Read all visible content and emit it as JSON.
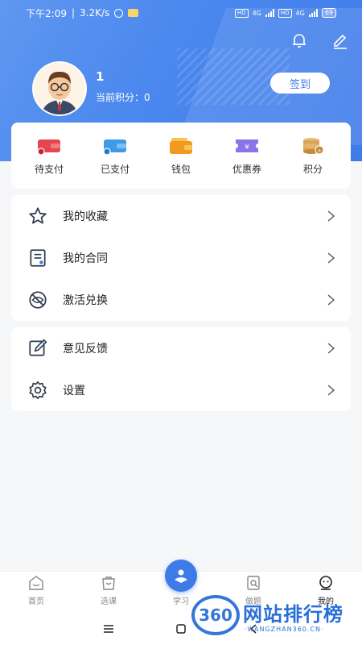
{
  "status_bar": {
    "time": "下午2:09",
    "speed": "3.2K/s",
    "network_1": "4G",
    "network_2": "4G",
    "hd": "HD",
    "battery": "69"
  },
  "header": {
    "user_name": "1",
    "points_text": "当前积分：0",
    "checkin_label": "签到",
    "colors": {
      "primary": "#3f7be8",
      "gradient_start": "#5f97f0"
    }
  },
  "quick_actions": [
    {
      "label": "待支付",
      "icon": "wallet-pending-icon",
      "color": "#e6464f"
    },
    {
      "label": "已支付",
      "icon": "wallet-paid-icon",
      "color": "#3f9be8"
    },
    {
      "label": "钱包",
      "icon": "wallet-icon",
      "color": "#f29a1f"
    },
    {
      "label": "优惠券",
      "icon": "coupon-icon",
      "color": "#8a74e8"
    },
    {
      "label": "积分",
      "icon": "coins-icon",
      "color": "#d9a55a"
    }
  ],
  "menu_group_1": [
    {
      "label": "我的收藏",
      "icon": "star-icon"
    },
    {
      "label": "我的合同",
      "icon": "contract-icon"
    },
    {
      "label": "激活兑换",
      "icon": "activate-icon"
    }
  ],
  "menu_group_2": [
    {
      "label": "意见反馈",
      "icon": "feedback-icon"
    },
    {
      "label": "设置",
      "icon": "gear-icon"
    }
  ],
  "bottom_nav": [
    {
      "label": "首页",
      "icon": "home-icon",
      "active": false
    },
    {
      "label": "选课",
      "icon": "course-select-icon",
      "active": false
    },
    {
      "label": "学习",
      "icon": "study-icon",
      "active": false
    },
    {
      "label": "做题",
      "icon": "exercise-icon",
      "active": false
    },
    {
      "label": "我的",
      "icon": "profile-icon",
      "active": true
    }
  ],
  "watermark": {
    "logo": "360",
    "title": "网站排行榜",
    "url": "·WANGZHAN360.CN·"
  }
}
